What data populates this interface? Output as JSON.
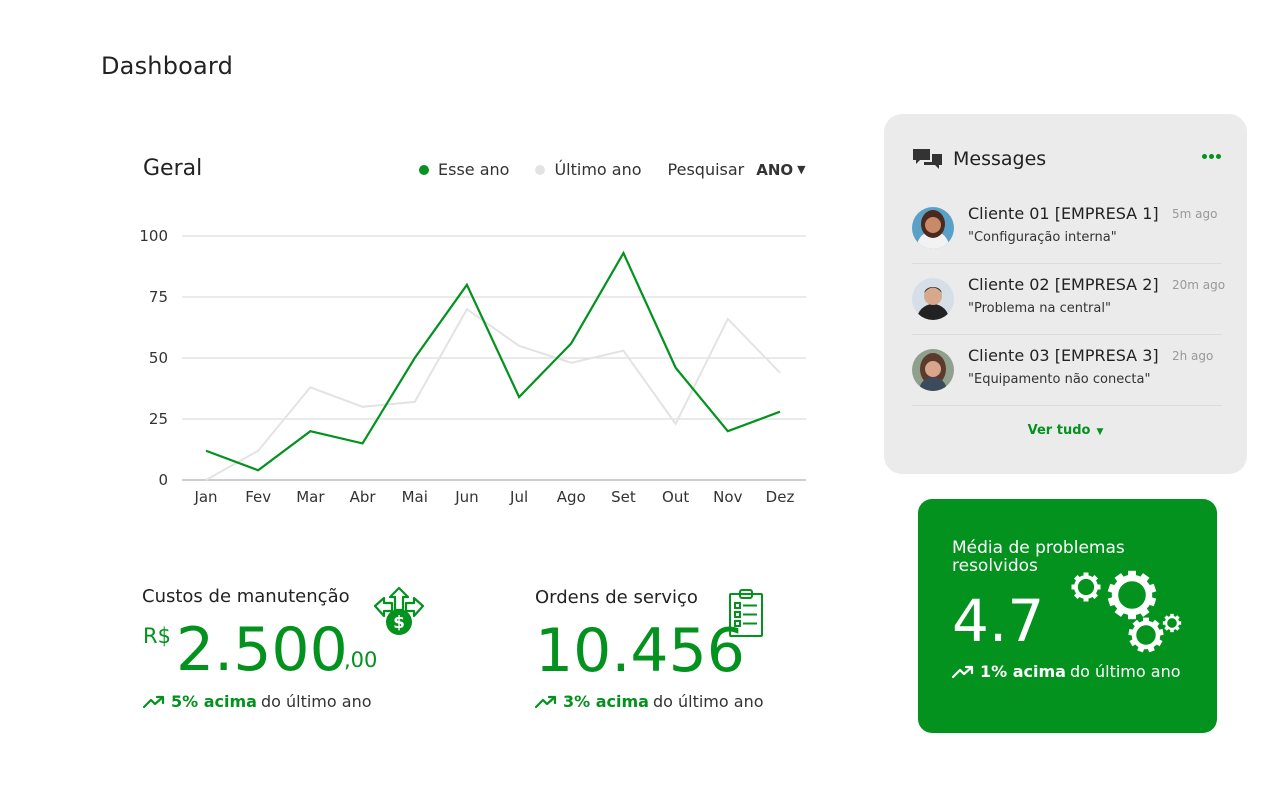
{
  "page": {
    "title": "Dashboard"
  },
  "chart_card": {
    "title": "Geral",
    "legend": {
      "this_year": "Esse ano",
      "last_year": "Último ano"
    },
    "search_label": "Pesquisar",
    "search_value": "ANO"
  },
  "chart_data": {
    "type": "line",
    "title": "Geral",
    "categories": [
      "Jan",
      "Fev",
      "Mar",
      "Abr",
      "Mai",
      "Jun",
      "Jul",
      "Ago",
      "Set",
      "Out",
      "Nov",
      "Dez"
    ],
    "series": [
      {
        "name": "Esse ano",
        "color": "#03921e",
        "values": [
          12,
          4,
          20,
          15,
          50,
          80,
          34,
          56,
          93,
          46,
          20,
          28
        ]
      },
      {
        "name": "Último ano",
        "color": "#e3e3e3",
        "values": [
          0,
          12,
          38,
          30,
          32,
          70,
          55,
          48,
          53,
          23,
          66,
          44
        ]
      }
    ],
    "yticks": [
      0,
      25,
      50,
      75,
      100
    ],
    "ylim": [
      0,
      100
    ],
    "grid": true,
    "legend_position": "top-right"
  },
  "kpis": {
    "costs": {
      "title": "Custos de manutenção",
      "currency": "R$",
      "value": "2.500",
      "decimals": ",00",
      "highlight": "5% acima",
      "suffix": "do último ano",
      "icon": "money-distribution-icon"
    },
    "orders": {
      "title": "Ordens de serviço",
      "value": "10.456",
      "highlight": "3% acima",
      "suffix": "do último ano",
      "icon": "clipboard-checklist-icon"
    }
  },
  "messages": {
    "title": "Messages",
    "items": [
      {
        "name": "Cliente 01 [EMPRESA 1]",
        "time": "5m ago",
        "text": "\"Configuração interna\""
      },
      {
        "name": "Cliente 02 [EMPRESA 2]",
        "time": "20m ago",
        "text": "\"Problema na central\""
      },
      {
        "name": "Cliente 03 [EMPRESA 3]",
        "time": "2h ago",
        "text": "\"Equipamento não conecta\""
      }
    ],
    "see_all": "Ver tudo"
  },
  "resolved": {
    "title": "Média de problemas resolvidos",
    "value": "4.7",
    "highlight": "1% acima",
    "suffix": "do último ano",
    "icon": "gears-icon"
  },
  "colors": {
    "accent": "#03921e",
    "muted_line": "#e3e3e3",
    "card_bg": "#ebebeb"
  }
}
